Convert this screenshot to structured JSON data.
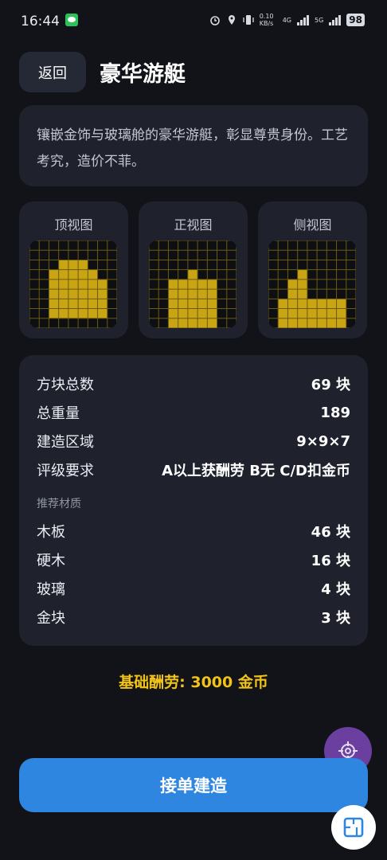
{
  "status_bar": {
    "time": "16:44",
    "speed": "0.10 KB/s",
    "net1": "4G",
    "net2": "5G",
    "battery": "98"
  },
  "header": {
    "back_label": "返回",
    "title": "豪华游艇"
  },
  "description": "镶嵌金饰与玻璃舱的豪华游艇，彰显尊贵身份。工艺考究，造价不菲。",
  "views": [
    {
      "label": "顶视图",
      "heights": [
        0,
        0,
        0,
        5,
        5,
        5,
        0,
        0,
        0
      ],
      "style": "top"
    },
    {
      "label": "正视图",
      "heights": [
        0,
        0,
        5,
        5,
        6,
        5,
        5,
        0,
        0
      ]
    },
    {
      "label": "侧视图",
      "heights": [
        0,
        3,
        5,
        6,
        3,
        3,
        3,
        3,
        0
      ]
    }
  ],
  "stats": {
    "block_count_label": "方块总数",
    "block_count_value": "69 块",
    "weight_label": "总重量",
    "weight_value": "189",
    "area_label": "建造区域",
    "area_value": "9×9×7",
    "grade_label": "评级要求",
    "grade_value": "A以上获酬劳 B无 C/D扣金币",
    "materials_heading": "推荐材质",
    "materials": [
      {
        "name": "木板",
        "qty": "46 块"
      },
      {
        "name": "硬木",
        "qty": "16 块"
      },
      {
        "name": "玻璃",
        "qty": "4 块"
      },
      {
        "name": "金块",
        "qty": "3 块"
      }
    ]
  },
  "reward_text": "基础酬劳: 3000 金币",
  "accept_label": "接单建造",
  "colors": {
    "gold": "#f2c319",
    "block_fill": "#c9a514",
    "accent_blue": "#2f86e0",
    "purple_fab": "#6a3fa0"
  }
}
